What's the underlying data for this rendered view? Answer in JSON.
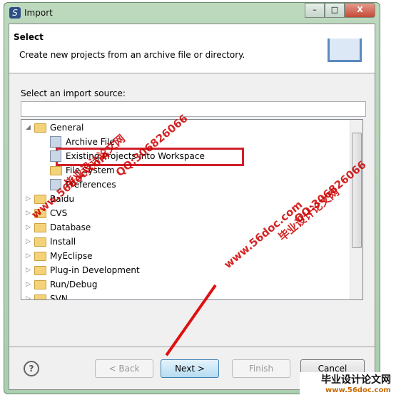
{
  "window": {
    "title": "Import",
    "controls": [
      "minimize",
      "maximize",
      "close"
    ]
  },
  "header": {
    "title": "Select",
    "description": "Create new projects from an archive file or directory."
  },
  "source": {
    "label": "Select an import source:",
    "filter_value": "",
    "filter_placeholder": ""
  },
  "tree": [
    {
      "label": "General",
      "expanded": true,
      "level": 0,
      "icon": "folder-icon"
    },
    {
      "label": "Archive File",
      "level": 1,
      "icon": "archive-icon"
    },
    {
      "label": "Existing Projects into Workspace",
      "level": 1,
      "icon": "project-folder-icon",
      "selected": true
    },
    {
      "label": "File System",
      "level": 1,
      "icon": "folder-icon"
    },
    {
      "label": "Preferences",
      "level": 1,
      "icon": "preferences-icon"
    },
    {
      "label": "Baidu",
      "level": 0,
      "icon": "folder-icon"
    },
    {
      "label": "CVS",
      "level": 0,
      "icon": "folder-icon"
    },
    {
      "label": "Database",
      "level": 0,
      "icon": "folder-icon"
    },
    {
      "label": "Install",
      "level": 0,
      "icon": "folder-icon"
    },
    {
      "label": "MyEclipse",
      "level": 0,
      "icon": "folder-icon"
    },
    {
      "label": "Plug-in Development",
      "level": 0,
      "icon": "folder-icon"
    },
    {
      "label": "Run/Debug",
      "level": 0,
      "icon": "folder-icon"
    },
    {
      "label": "SVN",
      "level": 0,
      "icon": "folder-icon"
    }
  ],
  "buttons": {
    "back": "< Back",
    "next": "Next >",
    "finish": "Finish",
    "cancel": "Cancel"
  },
  "watermark": {
    "site": "www.56doc.com",
    "qq": "QQ:306826066",
    "cn": "毕业设计论文网"
  },
  "colors": {
    "highlight": "#d0202a",
    "accent": "#3c7fb1"
  }
}
